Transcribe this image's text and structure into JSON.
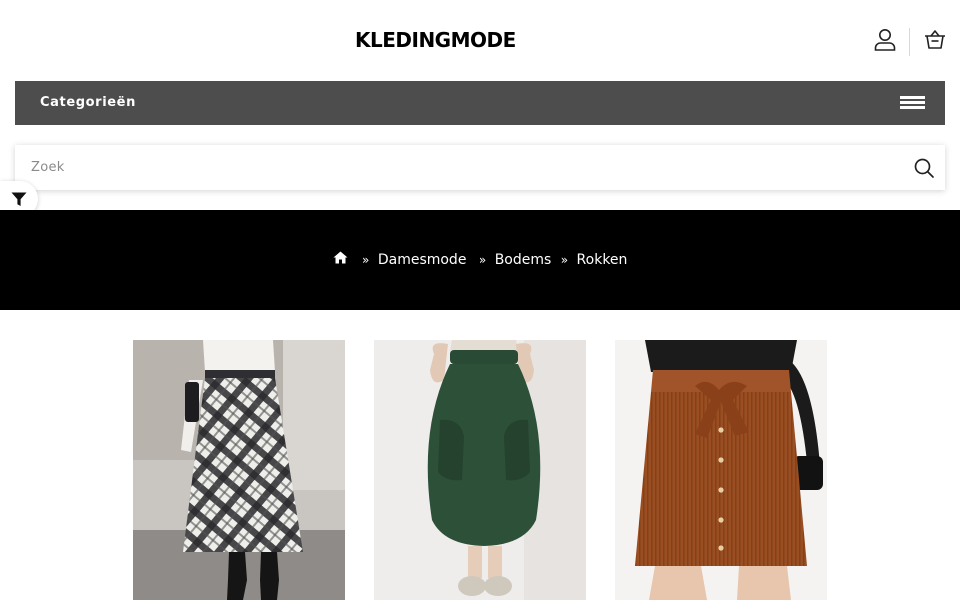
{
  "header": {
    "logo": "KLEDINGMODE",
    "account_icon": "user-icon",
    "cart_icon": "basket-icon"
  },
  "categories": {
    "label": "Categorieën",
    "menu_icon": "hamburger-icon"
  },
  "search": {
    "placeholder": "Zoek",
    "value": "",
    "icon": "search-icon"
  },
  "filter": {
    "icon": "filter-icon"
  },
  "breadcrumb": {
    "home_icon": "home-icon",
    "items": [
      "Damesmode",
      "Bodems",
      "Rokken"
    ]
  },
  "products": [
    {
      "image": "plaid-maxi-skirt"
    },
    {
      "image": "green-balloon-skirt"
    },
    {
      "image": "brown-corduroy-mini-skirt"
    }
  ],
  "colors": {
    "category_bar": "#4d4d4d",
    "breadcrumb_band": "#000000",
    "background": "#ffffff"
  }
}
